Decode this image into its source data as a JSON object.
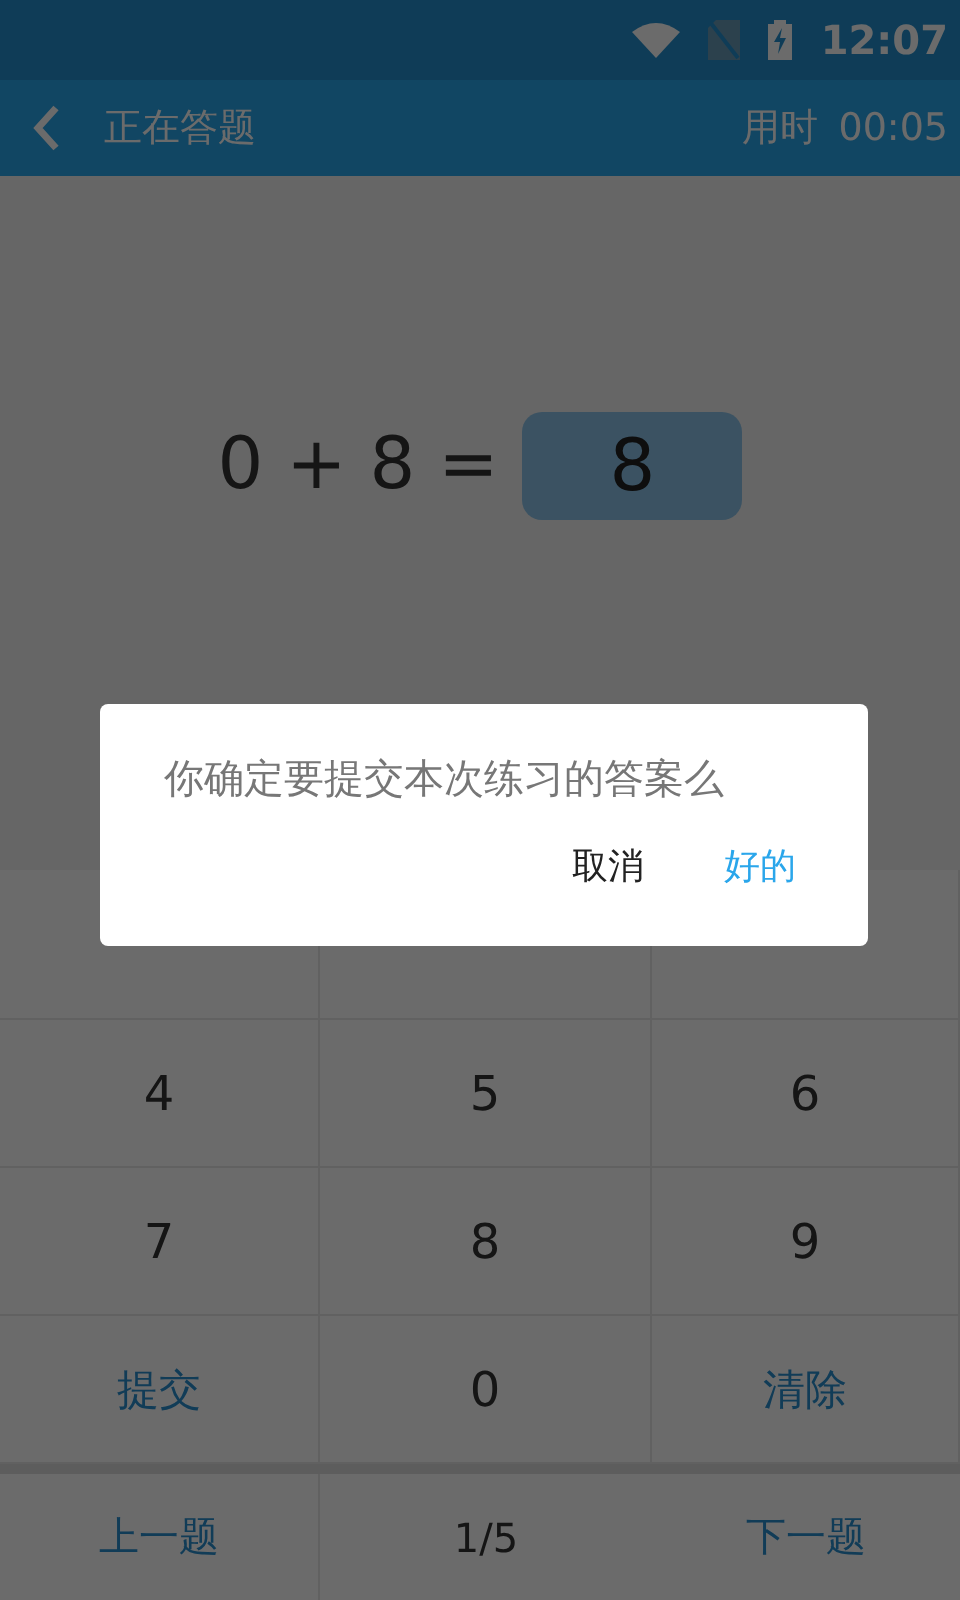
{
  "status_bar": {
    "time": "12:07"
  },
  "header": {
    "title": "正在答题",
    "timer_label": "用时",
    "timer": "00:05"
  },
  "question": {
    "expression": "0 + 8 =",
    "answer": "8"
  },
  "keypad": [
    {
      "label": "4",
      "kind": "digit"
    },
    {
      "label": "5",
      "kind": "digit"
    },
    {
      "label": "6",
      "kind": "digit"
    },
    {
      "label": "7",
      "kind": "digit"
    },
    {
      "label": "8",
      "kind": "digit"
    },
    {
      "label": "9",
      "kind": "digit"
    },
    {
      "label": "提交",
      "kind": "action"
    },
    {
      "label": "0",
      "kind": "digit"
    },
    {
      "label": "清除",
      "kind": "action"
    }
  ],
  "navigation": {
    "previous": "上一题",
    "page": "1/5",
    "next": "下一题"
  },
  "dialog": {
    "message": "你确定要提交本次练习的答案么",
    "buttons": [
      {
        "label": "取消",
        "kind": "cancel"
      },
      {
        "label": "好的",
        "kind": "confirm"
      }
    ]
  }
}
